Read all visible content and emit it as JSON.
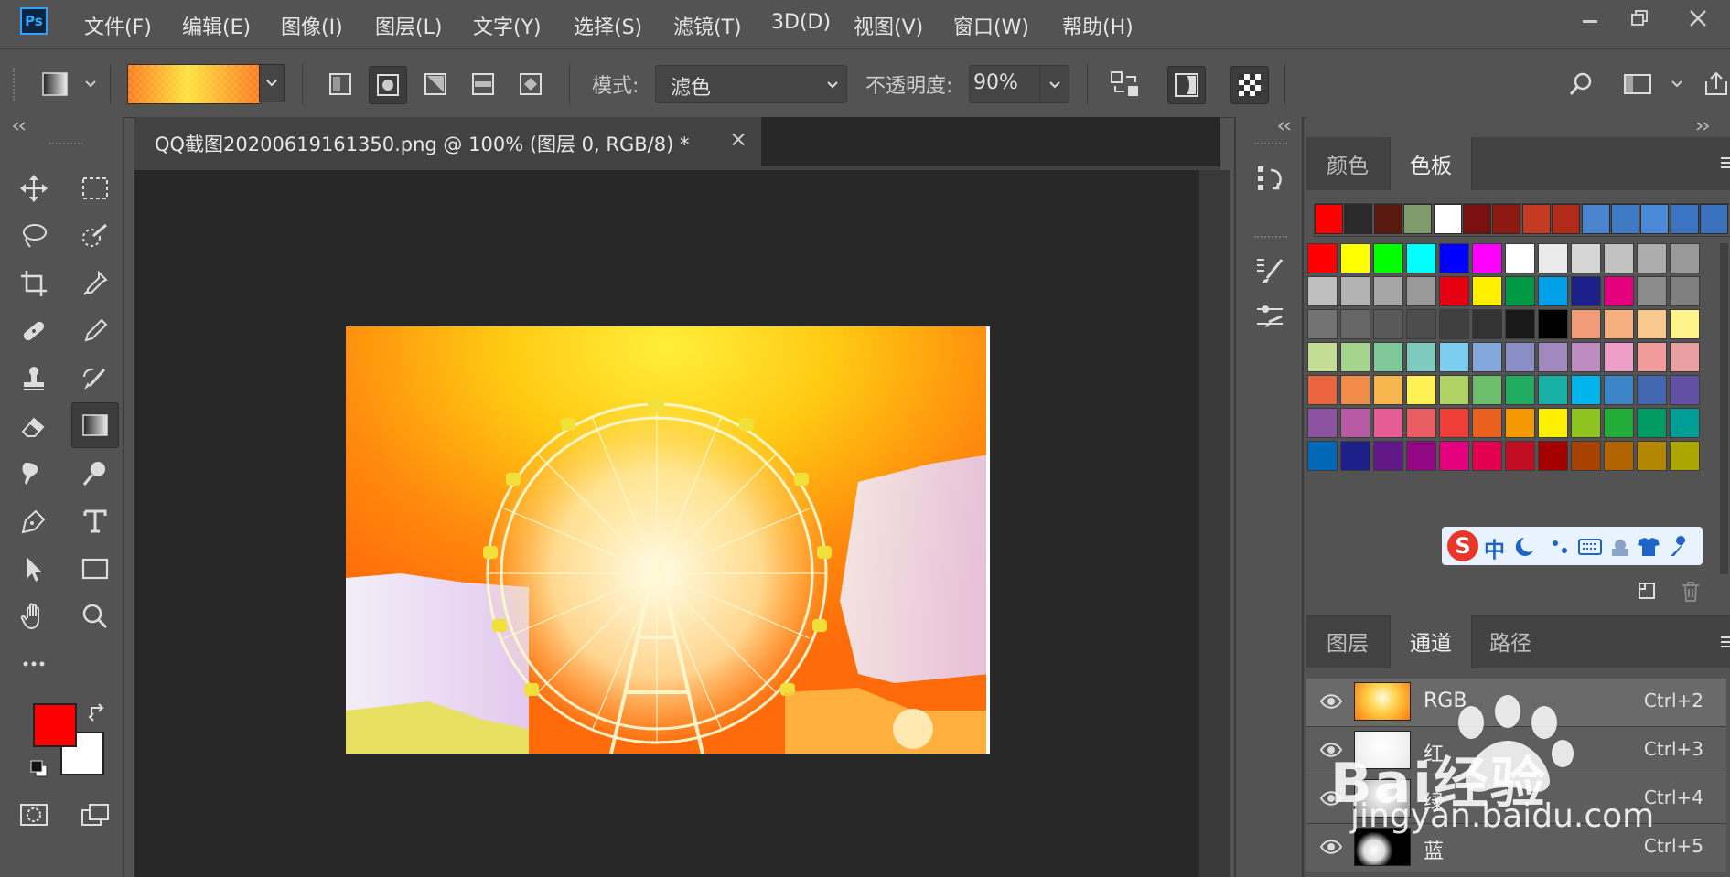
{
  "app": {
    "logo": "Ps"
  },
  "menu": {
    "items": [
      "文件(F)",
      "编辑(E)",
      "图像(I)",
      "图层(L)",
      "文字(Y)",
      "选择(S)",
      "滤镜(T)",
      "3D(D)",
      "视图(V)",
      "窗口(W)",
      "帮助(H)"
    ]
  },
  "options": {
    "mode_label": "模式:",
    "mode_value": "滤色",
    "opacity_label": "不透明度:",
    "opacity_value": "90%"
  },
  "document": {
    "tab_title": "QQ截图20200619161350.png @ 100% (图层 0, RGB/8) *",
    "close_symbol": "×"
  },
  "swatches_panel": {
    "tabs": [
      "颜色",
      "色板"
    ],
    "active_tab": "色板",
    "recent": [
      "#ff0000",
      "#2a2a2a",
      "#5a1a10",
      "#7f9b6c",
      "#ffffff",
      "#7b1010",
      "#8c1a12",
      "#c43a22",
      "#b22a18",
      "#4a86d0",
      "#3f7ac4",
      "#4b8ad8",
      "#3a74c2",
      "#3a72c0"
    ],
    "grid": [
      [
        "#ff0000",
        "#ffff00",
        "#00ff00",
        "#00ffff",
        "#0000ff",
        "#ff00ff",
        "#ffffff",
        "#ebebeb",
        "#d6d6d6",
        "#c2c2c2",
        "#adadad",
        "#999999"
      ],
      [
        "#bfbfbf",
        "#b3b3b3",
        "#a6a6a6",
        "#999999",
        "#e60012",
        "#fff100",
        "#009944",
        "#00a0e9",
        "#1d2088",
        "#e4007f",
        "#8c8c8c",
        "#808080"
      ],
      [
        "#737373",
        "#666666",
        "#595959",
        "#4d4d4d",
        "#404040",
        "#333333",
        "#1a1a1a",
        "#000000",
        "#f19c79",
        "#f6b07f",
        "#fac98d",
        "#fef48a"
      ],
      [
        "#c4dd95",
        "#a5d48c",
        "#7ec89a",
        "#7dcabf",
        "#7ccdf0",
        "#84a8dc",
        "#8a8dc6",
        "#a189c0",
        "#bf8cc2",
        "#ed9ec7",
        "#f29b9d",
        "#e8a0a0"
      ],
      [
        "#eb6640",
        "#f08c47",
        "#f6b54d",
        "#fff153",
        "#b1d366",
        "#6cbd6c",
        "#22ac62",
        "#19b1a6",
        "#00b5ec",
        "#3b85c8",
        "#4367b1",
        "#6250a4"
      ],
      [
        "#8e52a2",
        "#b85aa3",
        "#e65d96",
        "#e85d62",
        "#ee3e35",
        "#e9601f",
        "#f39800",
        "#ffef00",
        "#8fc31f",
        "#22ac38",
        "#009b63",
        "#009e96"
      ],
      [
        "#0068b7",
        "#1d2088",
        "#601986",
        "#920783",
        "#e4007f",
        "#e5004f",
        "#c30d23",
        "#a40000",
        "#a84200",
        "#b26400",
        "#b28600",
        "#aea600"
      ]
    ],
    "ime_label": "中"
  },
  "channels_panel": {
    "tabs": [
      "图层",
      "通道",
      "路径"
    ],
    "active_tab": "通道",
    "rows": [
      {
        "name": "RGB",
        "shortcut": "Ctrl+2"
      },
      {
        "name": "红",
        "shortcut": "Ctrl+3"
      },
      {
        "name": "绿",
        "shortcut": "Ctrl+4"
      },
      {
        "name": "蓝",
        "shortcut": "Ctrl+5"
      }
    ]
  },
  "colors": {
    "foreground": "#ff0000",
    "background": "#ffffff"
  },
  "watermark": {
    "brand": "Bai经验",
    "url": "jingyan.baidu.com"
  }
}
